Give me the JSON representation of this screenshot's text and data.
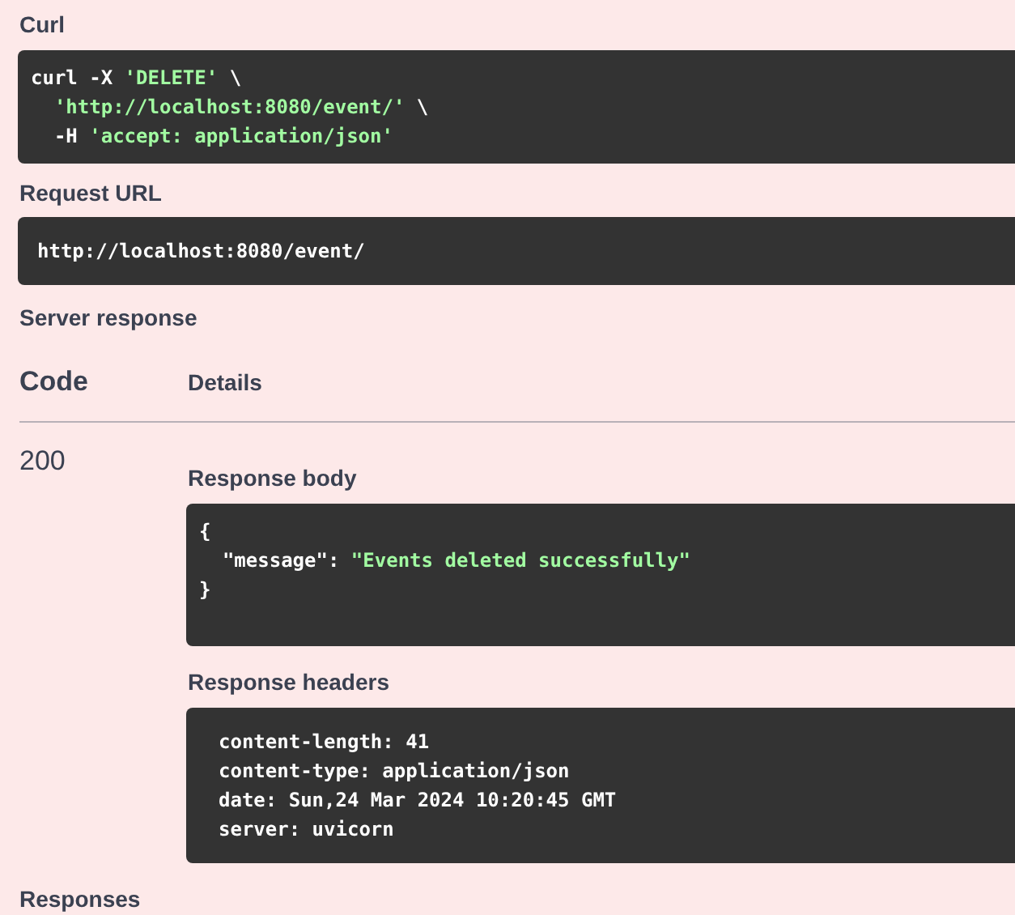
{
  "curl": {
    "label": "Curl",
    "lines": [
      [
        {
          "text": "curl -X ",
          "kind": "plain"
        },
        {
          "text": "'DELETE'",
          "kind": "string"
        },
        {
          "text": " \\",
          "kind": "plain"
        }
      ],
      [
        {
          "text": "  'http://localhost:8080/event/'",
          "kind": "string"
        },
        {
          "text": " \\",
          "kind": "plain"
        }
      ],
      [
        {
          "text": "  -H ",
          "kind": "plain"
        },
        {
          "text": "'accept: application/json'",
          "kind": "string"
        }
      ]
    ]
  },
  "request_url": {
    "label": "Request URL",
    "value": "http://localhost:8080/event/"
  },
  "server_response": {
    "title": "Server response",
    "columns": [
      "Code",
      "Details"
    ],
    "code": "200",
    "body_label": "Response body",
    "body_lines": [
      [
        {
          "text": "{",
          "kind": "plain"
        }
      ],
      [
        {
          "text": "  \"message\": ",
          "kind": "plain"
        },
        {
          "text": "\"Events deleted successfully\"",
          "kind": "string"
        }
      ],
      [
        {
          "text": "}",
          "kind": "plain"
        }
      ]
    ],
    "headers_label": "Response headers",
    "headers": [
      "content-length: 41",
      "content-type: application/json",
      "date: Sun,24 Mar 2024 10:20:45 GMT",
      "server: uvicorn"
    ]
  },
  "responses_title": "Responses"
}
